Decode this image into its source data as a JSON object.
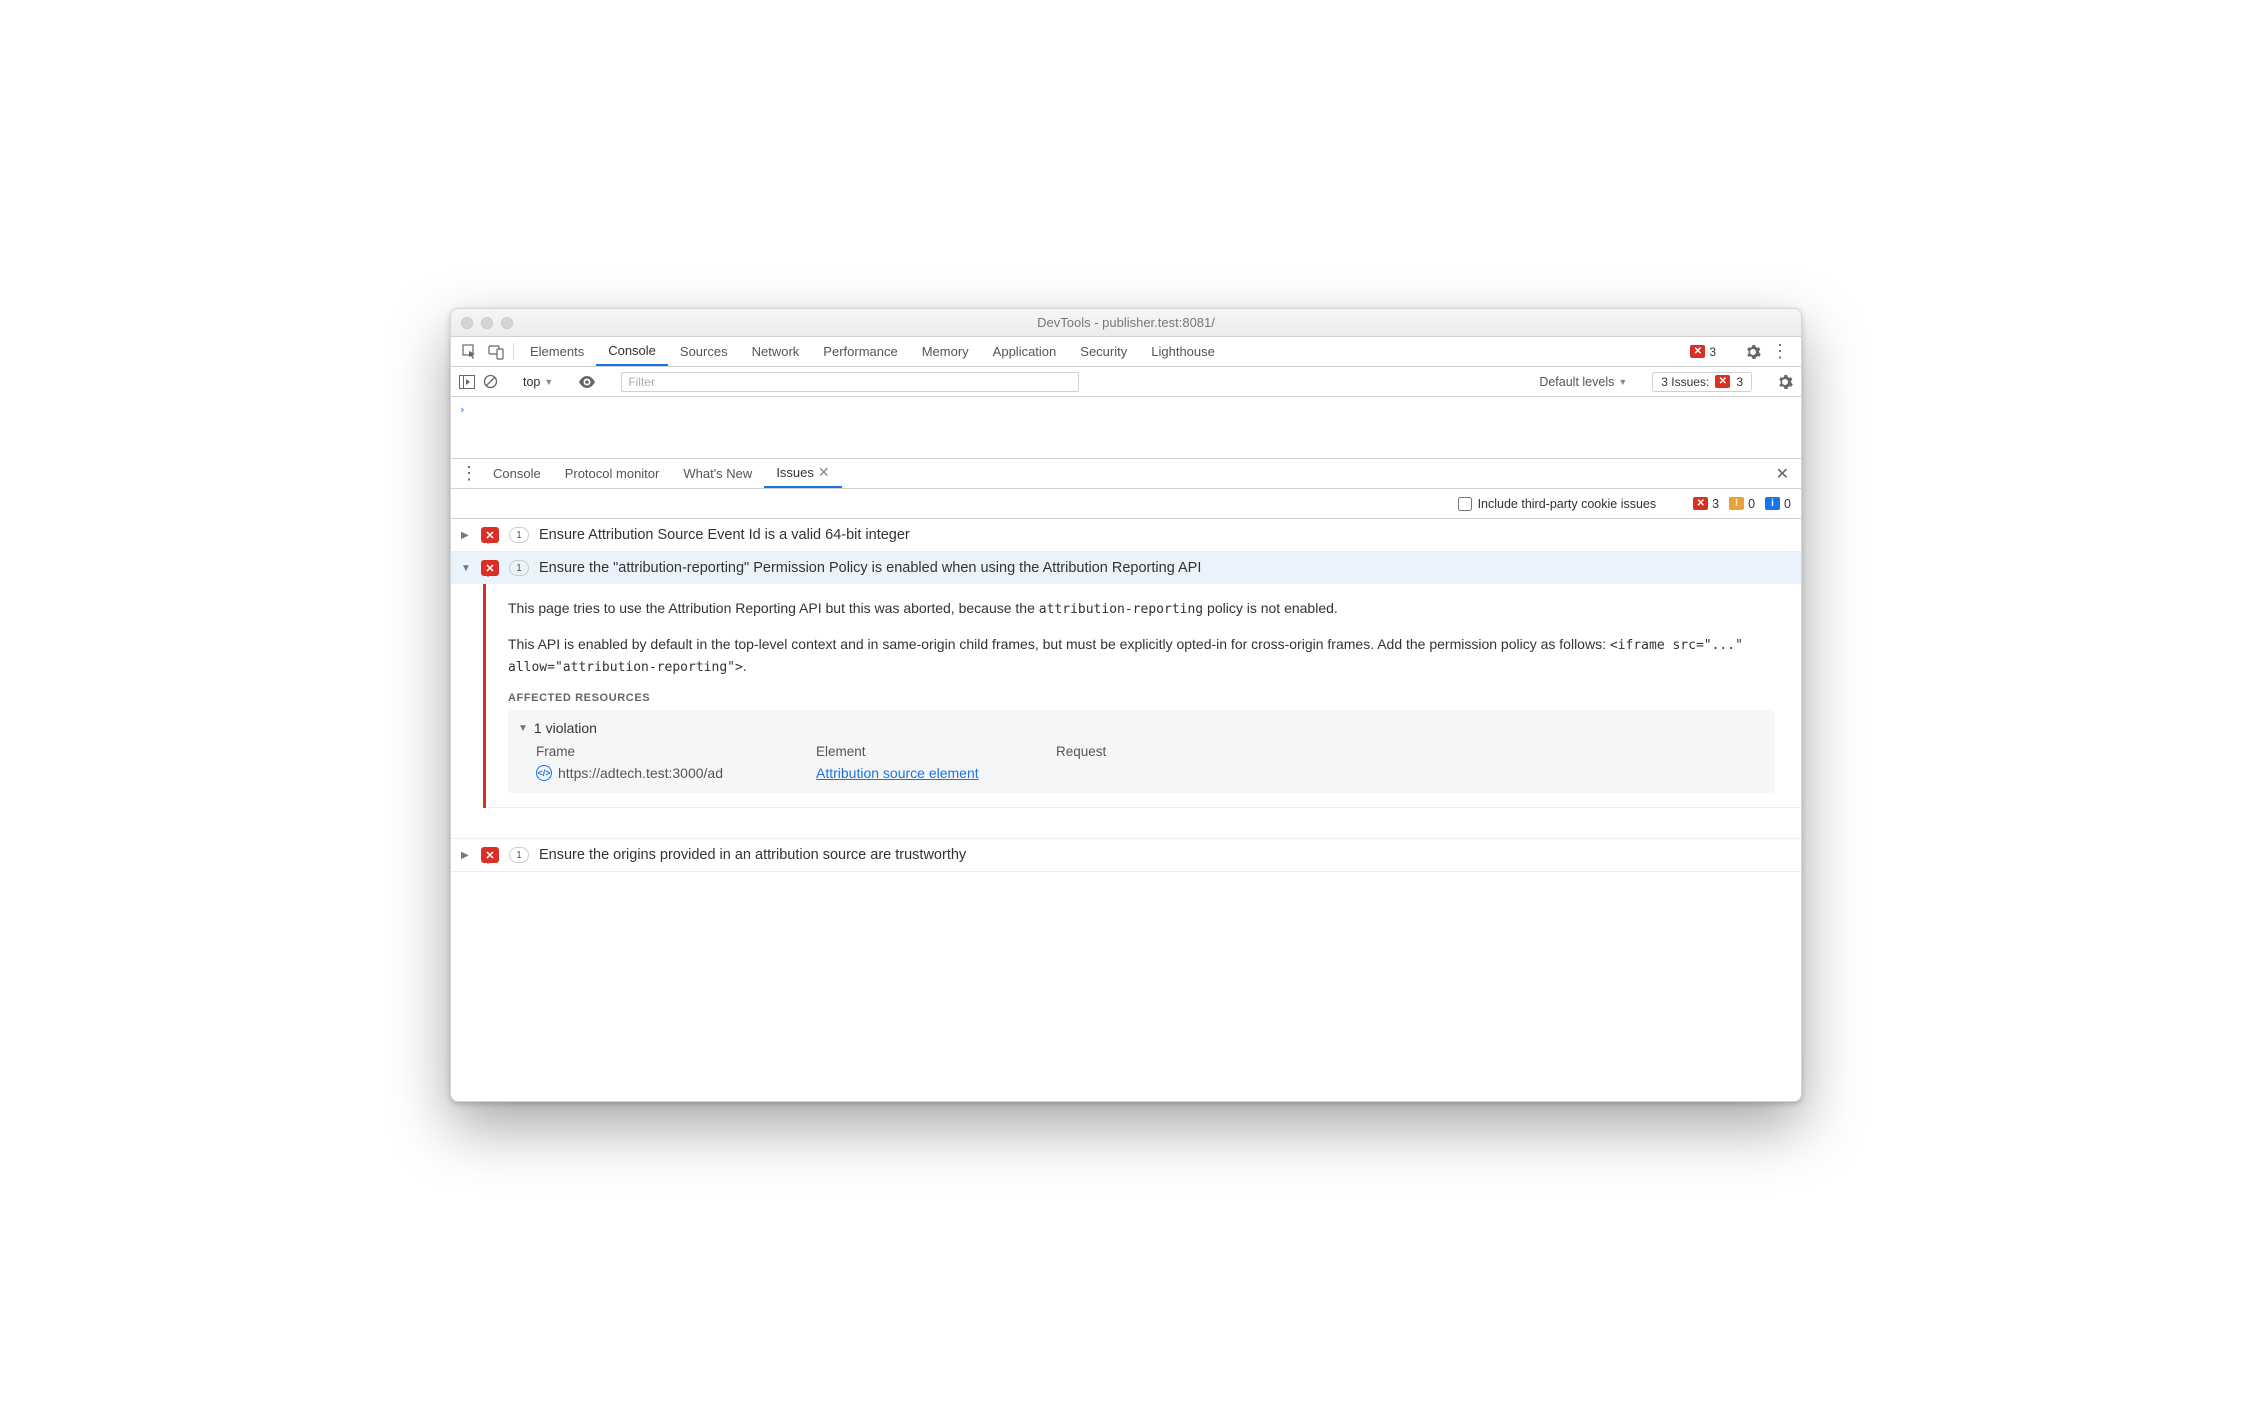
{
  "window": {
    "title": "DevTools - publisher.test:8081/"
  },
  "devtools_tabs": [
    "Elements",
    "Console",
    "Sources",
    "Network",
    "Performance",
    "Memory",
    "Application",
    "Security",
    "Lighthouse"
  ],
  "devtools_tabs_active": "Console",
  "top_error_count": "3",
  "console_toolbar": {
    "context": "top",
    "filter_placeholder": "Filter",
    "levels_label": "Default levels",
    "issues_label": "3 Issues:",
    "issues_count": "3"
  },
  "drawer_tabs": [
    "Console",
    "Protocol monitor",
    "What's New",
    "Issues"
  ],
  "drawer_tabs_active": "Issues",
  "issues_toolbar": {
    "checkbox_label": "Include third-party cookie issues",
    "red": "3",
    "orange": "0",
    "blue": "0"
  },
  "issues": [
    {
      "count": "1",
      "title": "Ensure Attribution Source Event Id is a valid 64-bit integer",
      "expanded": false
    },
    {
      "count": "1",
      "title": "Ensure the \"attribution-reporting\" Permission Policy is enabled when using the Attribution Reporting API",
      "expanded": true
    },
    {
      "count": "1",
      "title": "Ensure the origins provided in an attribution source are trustworthy",
      "expanded": false
    }
  ],
  "detail": {
    "p1_a": "This page tries to use the Attribution Reporting API but this was aborted, because the ",
    "p1_code": "attribution-reporting",
    "p1_b": " policy is not enabled.",
    "p2_a": "This API is enabled by default in the top-level context and in same-origin child frames, but must be explicitly opted-in for cross-origin frames. Add the permission policy as follows: ",
    "p2_code": "<iframe src=\"...\" allow=\"attribution-reporting\">",
    "p2_b": ".",
    "section": "AFFECTED RESOURCES",
    "violation_header": "1 violation",
    "col_frame": "Frame",
    "col_element": "Element",
    "col_request": "Request",
    "frame_url": "https://adtech.test:3000/ad",
    "element_link": "Attribution source element"
  }
}
